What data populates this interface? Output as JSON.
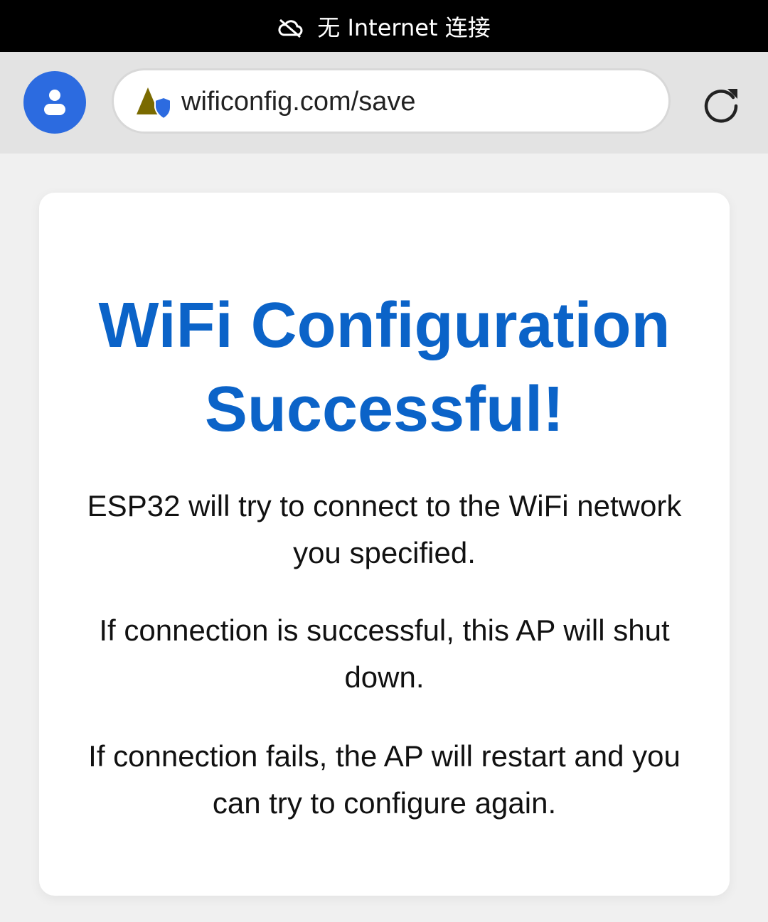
{
  "status_bar": {
    "icon": "cloud-off-icon",
    "text": "无 Internet 连接"
  },
  "browser": {
    "avatar_icon": "user-icon",
    "site_icon": "site-warning-shield-icon",
    "url": "wificonfig.com/save",
    "reload_icon": "reload-icon",
    "accent_color": "#2c6be0"
  },
  "page": {
    "title": "WiFi Configuration Successful!",
    "title_color": "#0b63c8",
    "paragraphs": [
      "ESP32 will try to connect to the WiFi network you specified.",
      "If connection is successful, this AP will shut down.",
      "If connection fails, the AP will restart and you can try to configure again."
    ]
  }
}
